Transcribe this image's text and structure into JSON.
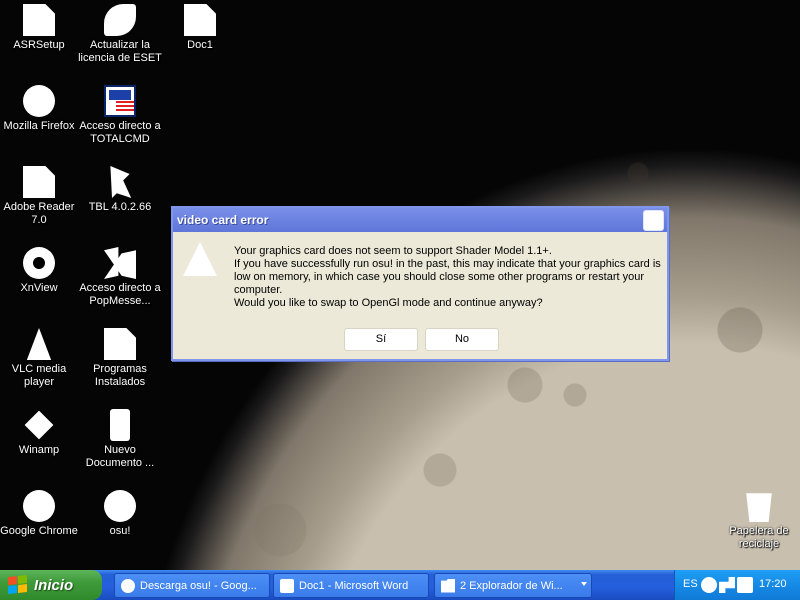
{
  "desktop": {
    "icons": [
      {
        "label": "ASRSetup",
        "icon": "generic-app-icon"
      },
      {
        "label": "Actualizar la licencia de ESET",
        "icon": "eset-icon"
      },
      {
        "label": "Doc1",
        "icon": "word-document-icon"
      },
      {
        "label": "Mozilla Firefox",
        "icon": "firefox-icon"
      },
      {
        "label": "Acceso directo a TOTALCMD",
        "icon": "totalcmd-icon"
      },
      {
        "label": "Adobe Reader 7.0",
        "icon": "adobe-reader-icon"
      },
      {
        "label": "TBL 4.0.2.66",
        "icon": "tbl-icon"
      },
      {
        "label": "XnView",
        "icon": "xnview-icon"
      },
      {
        "label": "Acceso directo a PopMesse...",
        "icon": "popmessenger-icon"
      },
      {
        "label": "VLC media player",
        "icon": "vlc-icon"
      },
      {
        "label": "Programas Instalados",
        "icon": "document-icon"
      },
      {
        "label": "Winamp",
        "icon": "winamp-icon"
      },
      {
        "label": "Nuevo Documento ...",
        "icon": "text-document-icon"
      },
      {
        "label": "Google Chrome",
        "icon": "chrome-icon"
      },
      {
        "label": "osu!",
        "icon": "osu-icon"
      },
      {
        "label": "Papelera de reciclaje",
        "icon": "recycle-bin-icon"
      }
    ]
  },
  "dialog": {
    "title": "video card error",
    "icon": "warning-icon",
    "message": [
      "Your graphics card does not seem to support Shader Model 1.1+.",
      "If you have successfully run osu! in the past, this may indicate that your graphics card is low on memory, in which case you should close some other programs or restart your computer.",
      "Would you like to swap to OpenGl mode and continue anyway?"
    ],
    "yes_label": "Sí",
    "no_label": "No"
  },
  "taskbar": {
    "start_label": "Inicio",
    "tasks": [
      {
        "label": "Descarga osu! - Goog...",
        "icon": "chrome-icon"
      },
      {
        "label": "Doc1 - Microsoft Word",
        "icon": "word-icon"
      },
      {
        "label": "2 Explorador de Wi...",
        "icon": "folder-icon"
      }
    ],
    "tray": {
      "language": "ES",
      "clock": "17:20"
    }
  },
  "colors": {
    "taskbar_blue": "#245edb",
    "start_green": "#3f9b3a",
    "dialog_face": "#ece9d8",
    "titlebar_blue": "#7a8fe8"
  }
}
